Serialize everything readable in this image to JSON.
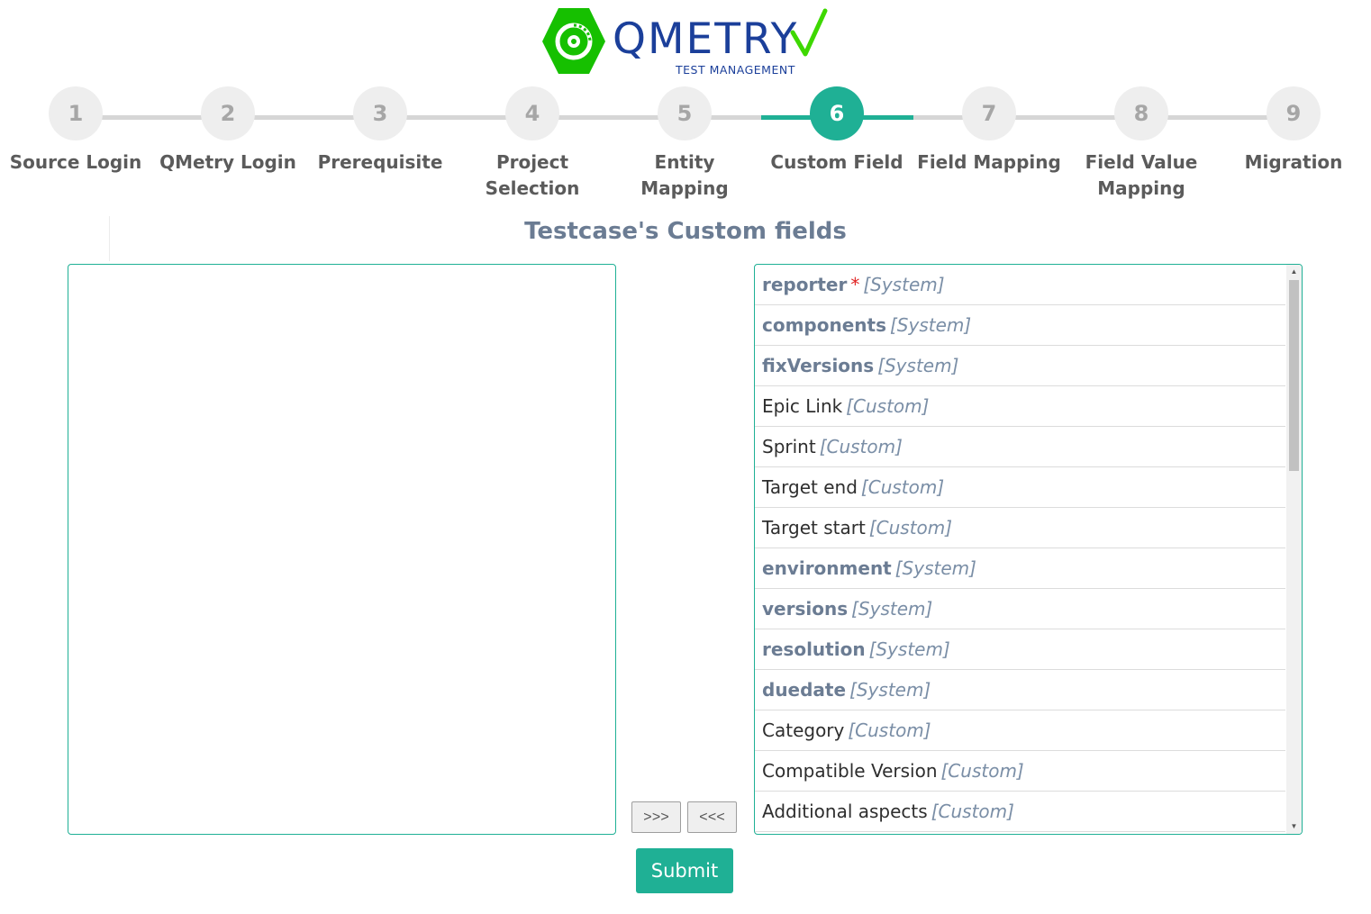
{
  "brand": {
    "name": "QMETRY",
    "tagline": "TEST MANAGEMENT",
    "hex_color": "#16c000",
    "text_color": "#1b3f9a",
    "check_color": "#3ed800"
  },
  "accent_color": "#1fb095",
  "stepper": {
    "active_step": 6,
    "steps": [
      {
        "number": "1",
        "label": "Source Login"
      },
      {
        "number": "2",
        "label": "QMetry Login"
      },
      {
        "number": "3",
        "label": "Prerequisite"
      },
      {
        "number": "4",
        "label": "Project Selection"
      },
      {
        "number": "5",
        "label": "Entity Mapping"
      },
      {
        "number": "6",
        "label": "Custom Field"
      },
      {
        "number": "7",
        "label": "Field Mapping"
      },
      {
        "number": "8",
        "label": "Field Value Mapping"
      },
      {
        "number": "9",
        "label": "Migration"
      }
    ]
  },
  "section": {
    "title": "Testcase's Custom fields"
  },
  "available_fields": [
    {
      "name": "reporter",
      "type": "[System]",
      "required": true,
      "required_mark": "*"
    },
    {
      "name": "components",
      "type": "[System]"
    },
    {
      "name": "fixVersions",
      "type": "[System]"
    },
    {
      "name": "Epic Link",
      "type": "[Custom]"
    },
    {
      "name": "Sprint",
      "type": "[Custom]"
    },
    {
      "name": "Target end",
      "type": "[Custom]"
    },
    {
      "name": "Target start",
      "type": "[Custom]"
    },
    {
      "name": "environment",
      "type": "[System]"
    },
    {
      "name": "versions",
      "type": "[System]"
    },
    {
      "name": "resolution",
      "type": "[System]"
    },
    {
      "name": "duedate",
      "type": "[System]"
    },
    {
      "name": "Category",
      "type": "[Custom]"
    },
    {
      "name": "Compatible Version",
      "type": "[Custom]"
    },
    {
      "name": "Additional aspects",
      "type": "[Custom]"
    }
  ],
  "buttons": {
    "move_right": ">>>",
    "move_left": "<<<",
    "submit": "Submit"
  }
}
